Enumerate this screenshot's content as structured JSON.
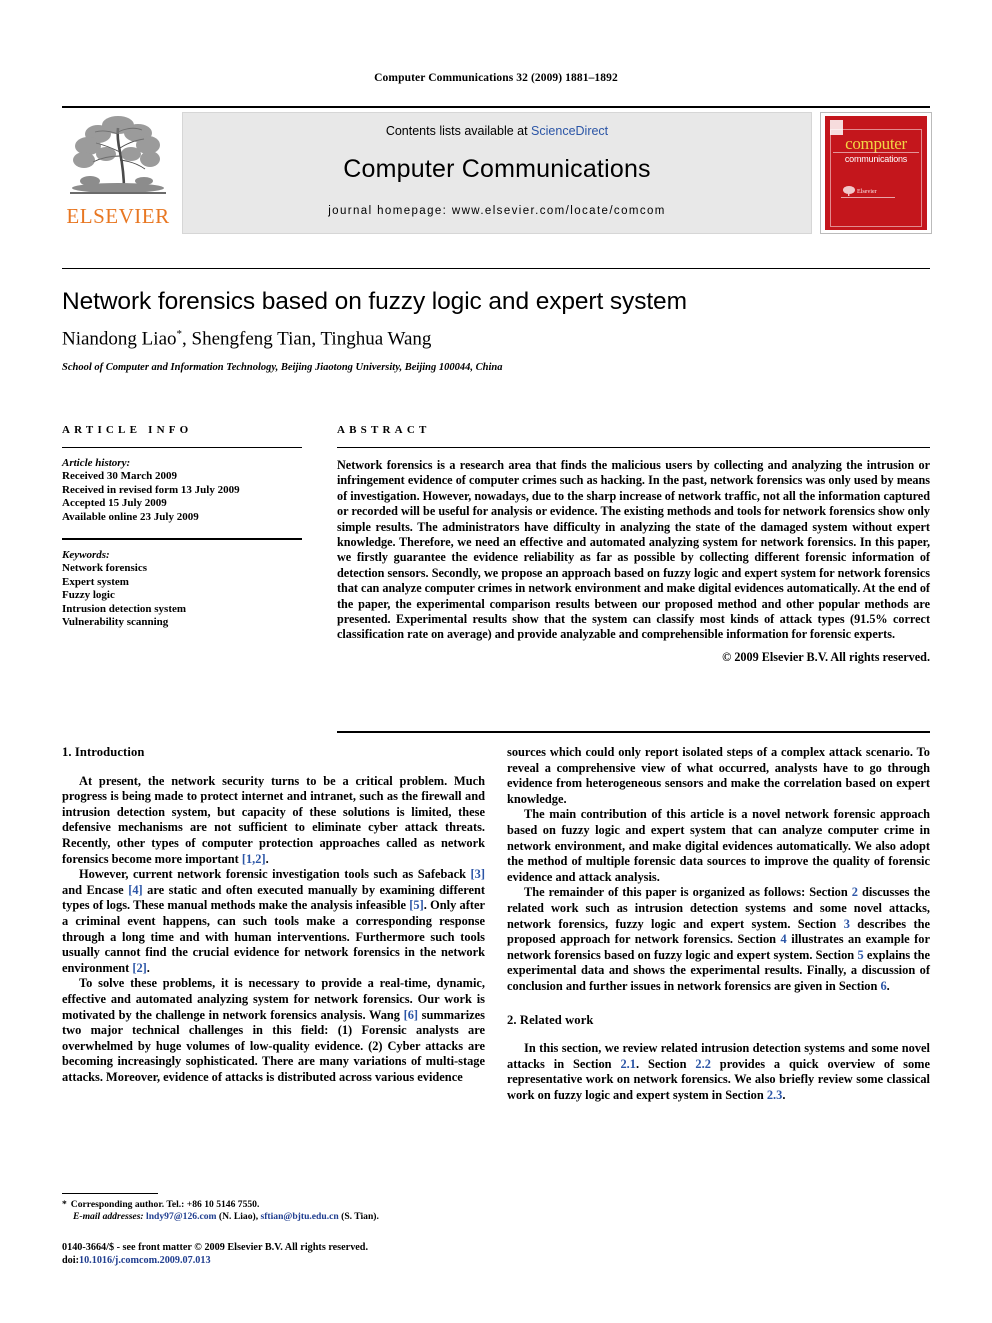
{
  "running_head": "Computer Communications 32 (2009) 1881–1892",
  "header": {
    "publisher_name": "ELSEVIER",
    "contents_prefix": "Contents lists available at ",
    "contents_link": "ScienceDirect",
    "journal_name": "Computer Communications",
    "homepage": "journal homepage: www.elsevier.com/locate/comcom",
    "cover": {
      "line1": "computer",
      "line2": "communications"
    }
  },
  "article": {
    "title": "Network forensics based on fuzzy logic and expert system",
    "authors": "Niandong Liao",
    "author_star": "*",
    "authors_rest": ", Shengfeng Tian, Tinghua Wang",
    "affiliation": "School of Computer and Information Technology, Beijing Jiaotong University, Beijing 100044, China"
  },
  "article_info": {
    "label": "ARTICLE INFO",
    "history_heading": "Article history:",
    "history": [
      "Received 30 March 2009",
      "Received in revised form 13 July 2009",
      "Accepted 15 July 2009",
      "Available online 23 July 2009"
    ],
    "keywords_heading": "Keywords:",
    "keywords": [
      "Network forensics",
      "Expert system",
      "Fuzzy logic",
      "Intrusion detection system",
      "Vulnerability scanning"
    ]
  },
  "abstract": {
    "label": "ABSTRACT",
    "text": "Network forensics is a research area that finds the malicious users by collecting and analyzing the intrusion or infringement evidence of computer crimes such as hacking. In the past, network forensics was only used by means of investigation. However, nowadays, due to the sharp increase of network traffic, not all the information captured or recorded will be useful for analysis or evidence. The existing methods and tools for network forensics show only simple results. The administrators have difficulty in analyzing the state of the damaged system without expert knowledge. Therefore, we need an effective and automated analyzing system for network forensics. In this paper, we firstly guarantee the evidence reliability as far as possible by collecting different forensic information of detection sensors. Secondly, we propose an approach based on fuzzy logic and expert system for network forensics that can analyze computer crimes in network environment and make digital evidences automatically. At the end of the paper, the experimental comparison results between our proposed method and other popular methods are presented. Experimental results show that the system can classify most kinds of attack types (91.5% correct classification rate on average) and provide analyzable and comprehensible information for forensic experts.",
    "copyright": "© 2009 Elsevier B.V. All rights reserved."
  },
  "body": {
    "intro_heading": "1. Introduction",
    "intro_p1_a": "At present, the network security turns to be a critical problem. Much progress is being made to protect internet and intranet, such as the firewall and intrusion detection system, but capacity of these solutions is limited, these defensive mechanisms are not sufficient to eliminate cyber attack threats. Recently, other types of computer protection approaches called as network forensics become more important ",
    "intro_p1_ref": "[1,2]",
    "intro_p1_b": ".",
    "intro_p2_a": "However, current network forensic investigation tools such as Safeback ",
    "intro_p2_ref1": "[3]",
    "intro_p2_b": " and Encase ",
    "intro_p2_ref2": "[4]",
    "intro_p2_c": " are static and often executed manually by examining different types of logs. These manual methods make the analysis infeasible ",
    "intro_p2_ref3": "[5]",
    "intro_p2_d": ". Only after a criminal event happens, can such tools make a corresponding response through a long time and with human interventions. Furthermore such tools usually cannot find the crucial evidence for network forensics in the network environment ",
    "intro_p2_ref4": "[2]",
    "intro_p2_e": ".",
    "intro_p3_a": "To solve these problems, it is necessary to provide a real-time, dynamic, effective and automated analyzing system for network forensics. Our work is motivated by the challenge in network forensics analysis. Wang ",
    "intro_p3_ref": "[6]",
    "intro_p3_b": " summarizes two major technical challenges in this field: (1) Forensic analysts are overwhelmed by huge volumes of low-quality evidence. (2) Cyber attacks are becoming increasingly sophisticated. There are many variations of multi-stage attacks. Moreover, evidence of attacks is distributed across various evidence",
    "right_p1": "sources which could only report isolated steps of a complex attack scenario. To reveal a comprehensive view of what occurred, analysts have to go through evidence from heterogeneous sensors and make the correlation based on expert knowledge.",
    "right_p2": "The main contribution of this article is a novel network forensic approach based on fuzzy logic and expert system that can analyze computer crime in network environment, and make digital evidences automatically. We also adopt the method of multiple forensic data sources to improve the quality of forensic evidence and attack analysis.",
    "right_p3_a": "The remainder of this paper is organized as follows: Section ",
    "right_p3_ref1": "2",
    "right_p3_b": " discusses the related work such as intrusion detection systems and some novel attacks, network forensics, fuzzy logic and expert system. Section ",
    "right_p3_ref2": "3",
    "right_p3_c": " describes the proposed approach for network forensics. Section ",
    "right_p3_ref3": "4",
    "right_p3_d": " illustrates an example for network forensics based on fuzzy logic and expert system. Section ",
    "right_p3_ref4": "5",
    "right_p3_e": " explains the experimental data and shows the experimental results. Finally, a discussion of conclusion and further issues in network forensics are given in Section ",
    "right_p3_ref5": "6",
    "right_p3_f": ".",
    "related_heading": "2. Related work",
    "related_p1_a": "In this section, we review related intrusion detection systems and some novel attacks in Section ",
    "related_p1_ref1": "2.1",
    "related_p1_b": ". Section ",
    "related_p1_ref2": "2.2",
    "related_p1_c": " provides a quick overview of some representative work on network forensics. We also briefly review some classical work on fuzzy logic and expert system in Section ",
    "related_p1_ref3": "2.3",
    "related_p1_d": "."
  },
  "footnotes": {
    "corresponding_star": "*",
    "corresponding": "Corresponding author. Tel.: +86 10 5146 7550.",
    "email_label": "E-mail addresses:",
    "email1": "lndy97@126.com",
    "email1_who": " (N. Liao), ",
    "email2": "sftian@bjtu.edu.cn",
    "email2_who": " (S. Tian)."
  },
  "imprint": {
    "line1": "0140-3664/$ - see front matter © 2009 Elsevier B.V. All rights reserved.",
    "doi_label": "doi:",
    "doi_value": "10.1016/j.comcom.2009.07.013"
  },
  "colors": {
    "link_blue": "#2B55A6",
    "elsevier_orange": "#E87722",
    "cover_red": "#C4161C",
    "cover_yellow": "#F2D544",
    "band_gray": "#e8e8e8"
  }
}
